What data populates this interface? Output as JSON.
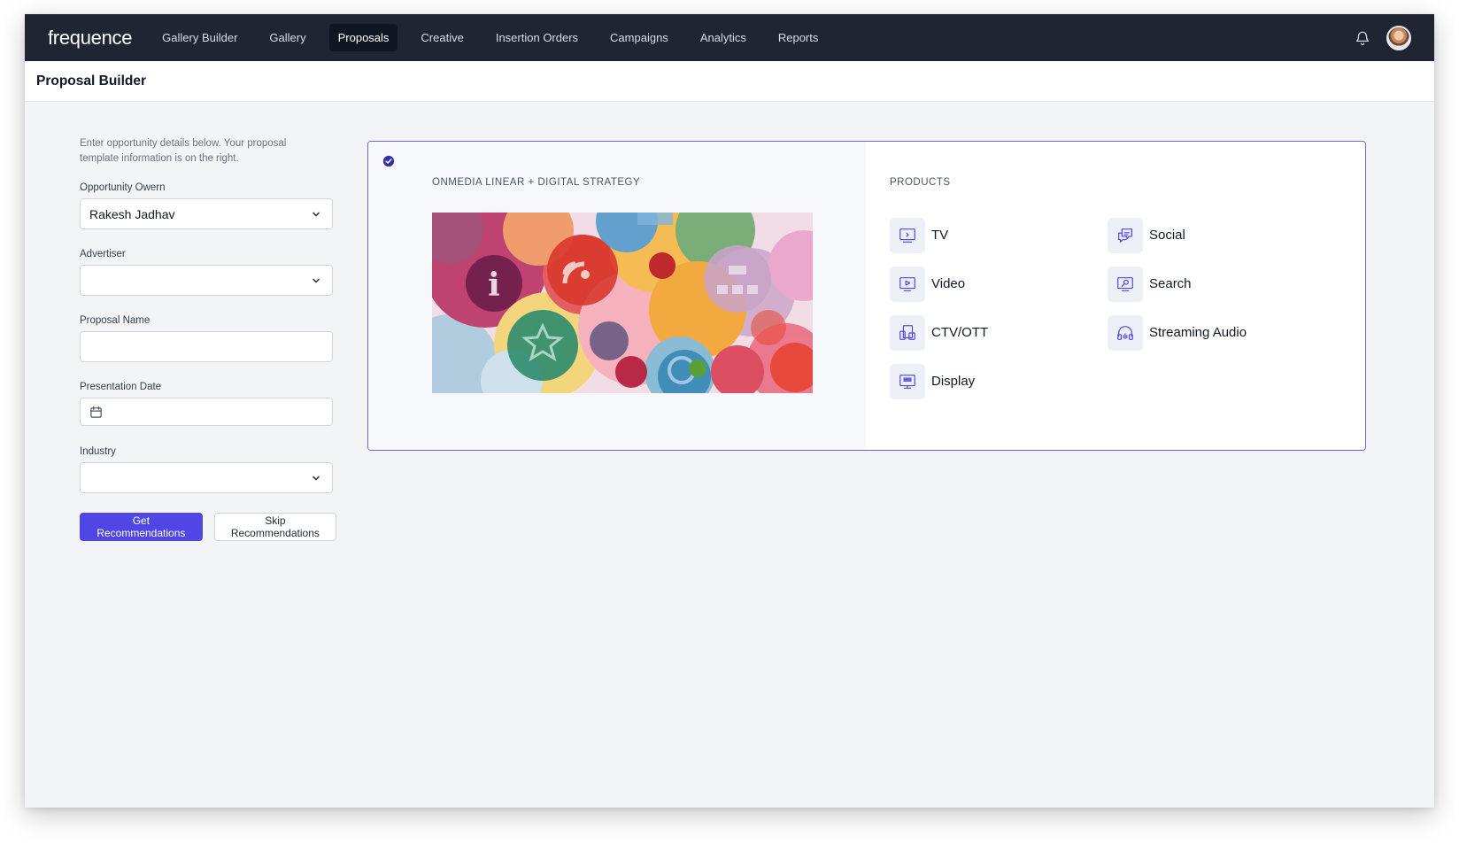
{
  "nav": {
    "logo": "frequence",
    "items": [
      {
        "label": "Gallery Builder",
        "active": false
      },
      {
        "label": "Gallery",
        "active": false
      },
      {
        "label": "Proposals",
        "active": true
      },
      {
        "label": "Creative",
        "active": false
      },
      {
        "label": "Insertion Orders",
        "active": false
      },
      {
        "label": "Campaigns",
        "active": false
      },
      {
        "label": "Analytics",
        "active": false
      },
      {
        "label": "Reports",
        "active": false
      }
    ],
    "icons": [
      "bell-icon",
      "avatar"
    ]
  },
  "page": {
    "title": "Proposal Builder"
  },
  "form": {
    "intro": "Enter opportunity details below. Your proposal template information is on the right.",
    "opportunity_owner": {
      "label": "Opportunity Owern",
      "value": "Rakesh Jadhav"
    },
    "advertiser": {
      "label": "Advertiser",
      "value": ""
    },
    "proposal_name": {
      "label": "Proposal Name",
      "value": ""
    },
    "presentation_date": {
      "label": "Presentation Date",
      "value": ""
    },
    "industry": {
      "label": "Industry",
      "value": ""
    },
    "get_recommendations": "Get Recommendations",
    "skip_recommendations": "Skip Recommendations"
  },
  "template": {
    "name": "ONMEDIA LINEAR + DIGITAL STRATEGY",
    "selected": true,
    "products_title": "PRODUCTS",
    "products": [
      {
        "label": "TV",
        "icon": "tv-icon"
      },
      {
        "label": "Social",
        "icon": "social-icon"
      },
      {
        "label": "Video",
        "icon": "video-icon"
      },
      {
        "label": "Search",
        "icon": "search-icon"
      },
      {
        "label": "CTV/OTT",
        "icon": "ctv-ott-icon"
      },
      {
        "label": "Streaming Audio",
        "icon": "headphones-icon"
      },
      {
        "label": "Display",
        "icon": "display-icon"
      }
    ]
  },
  "colors": {
    "nav_bg": "#1f2533",
    "accent": "#4f46e5",
    "card_border": "#6d63e6",
    "page_bg": "#f3f4f6"
  }
}
